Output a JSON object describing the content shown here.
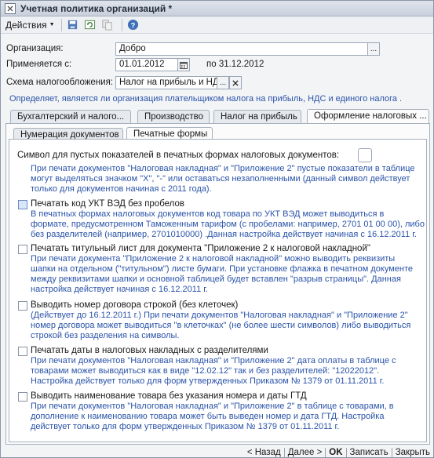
{
  "window": {
    "title": "Учетная политика организаций *"
  },
  "toolbar": {
    "actions_label": "Действия"
  },
  "form": {
    "org_label": "Организация:",
    "org_value": "Добро",
    "applies_label": "Применяется с:",
    "applies_value": "01.01.2012",
    "applies_to": "по 31.12.2012",
    "tax_label": "Схема налогообложения:",
    "tax_value": "Налог на прибыль и НДС",
    "tax_hint": "Определяет, является ли организация плательщиком налога на прибыль, НДС и единого налога ."
  },
  "tabs": [
    {
      "label": "Бухгалтерский и налого..."
    },
    {
      "label": "Производство"
    },
    {
      "label": "Налог на прибыль"
    },
    {
      "label": "Оформление налоговых ..."
    }
  ],
  "subtabs": [
    {
      "label": "Нумерация документов"
    },
    {
      "label": "Печатные формы"
    }
  ],
  "print": {
    "symbol_label": "Символ для пустых показателей в печатных формах налоговых документов:",
    "symbol_desc": [
      "При печати документов \"Налоговая накладная\" и \"Приложение 2\" пустые показатели в таблице",
      "могут выделяться значком \"X\", \"-\" или оставаться незаполненными  (данный символ действует",
      "только для документов начиная с 2011 года)."
    ],
    "opt1_label": "Печатать код УКТ ВЭД без пробелов",
    "opt1_desc": [
      "В печатных формах налоговых документов код товара по УКТ ВЭД может выводиться в",
      "формате, предусмотренном Таможенным тарифом (с пробелами: например, 2701 01 00 00), либо",
      "без разделителей (например, 2701010000) .Данная настройка действует начиная с 16.12.2011 г."
    ],
    "opt2_label": "Печатать титульный лист для документа \"Приложение 2 к налоговой накладной\"",
    "opt2_desc": [
      "При печати документа \"Приложение 2 к налоговой накладной\" можно выводить реквизиты",
      "шапки на отдельном (\"титульном\") листе бумаги. При установке флажка в печатном документе",
      "между реквизитами шапки и основной таблицей будет вставлен \"разрыв страницы\". Данная",
      "настройка действует начиная с 16.12.2011 г."
    ],
    "opt3_label": "Выводить номер договора строкой (без клеточек)",
    "opt3_desc": [
      "(Действует до 16.12.2011 г.) При печати документов \"Налоговая накладная\" и \"Приложение 2\"",
      "номер договора может выводиться \"в клеточках\" (не более шести символов) либо выводиться",
      "строкой без разделения на символы."
    ],
    "opt4_label": "Печатать даты в налоговых накладных с разделителями",
    "opt4_desc": [
      "При печати документов \"Налоговая накладная\" и \"Приложение 2\"  дата оплаты в таблице с",
      "товарами может выводиться как в виде  \"12.02.12\" так и без разделителей: \"12022012\".",
      "Настройка действует только для форм утвержденных Приказом № 1379 от 01.11.2011 г."
    ],
    "opt5_label": "Выводить наименование товара без указания номера и даты ГТД",
    "opt5_desc": [
      "При печати документов \"Налоговая накладная\" и \"Приложение 2\" в таблице с товарами, в",
      "дополнение к наименованию товара может быть выведен номер и дата ГТД. Настройка",
      "действует только для форм утвержденных Приказом № 1379 от 01.11.2011 г."
    ]
  },
  "bottom": {
    "back": "< Назад",
    "next": "Далее >",
    "ok": "OK",
    "save": "Записать",
    "close": "Закрыть"
  }
}
